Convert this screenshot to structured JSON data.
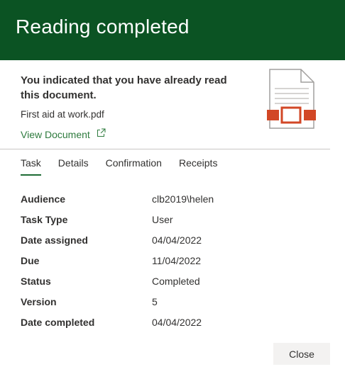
{
  "header": {
    "title": "Reading completed"
  },
  "intro": {
    "message": "You indicated that you have already read this document.",
    "filename": "First aid at work.pdf",
    "view_link": "View Document"
  },
  "icons": {
    "document": "document-icon",
    "external_link": "external-link-icon"
  },
  "colors": {
    "header_bg": "#0b5323",
    "link": "#2e7b3e",
    "icon_accent": "#d24726"
  },
  "tabs": [
    {
      "label": "Task",
      "active": true
    },
    {
      "label": "Details",
      "active": false
    },
    {
      "label": "Confirmation",
      "active": false
    },
    {
      "label": "Receipts",
      "active": false
    }
  ],
  "task": {
    "rows": [
      {
        "label": "Audience",
        "value": "clb2019\\helen"
      },
      {
        "label": "Task Type",
        "value": "User"
      },
      {
        "label": "Date assigned",
        "value": "04/04/2022"
      },
      {
        "label": "Due",
        "value": "11/04/2022"
      },
      {
        "label": "Status",
        "value": "Completed"
      },
      {
        "label": "Version",
        "value": "5"
      },
      {
        "label": "Date completed",
        "value": "04/04/2022"
      }
    ]
  },
  "footer": {
    "close_label": "Close"
  }
}
